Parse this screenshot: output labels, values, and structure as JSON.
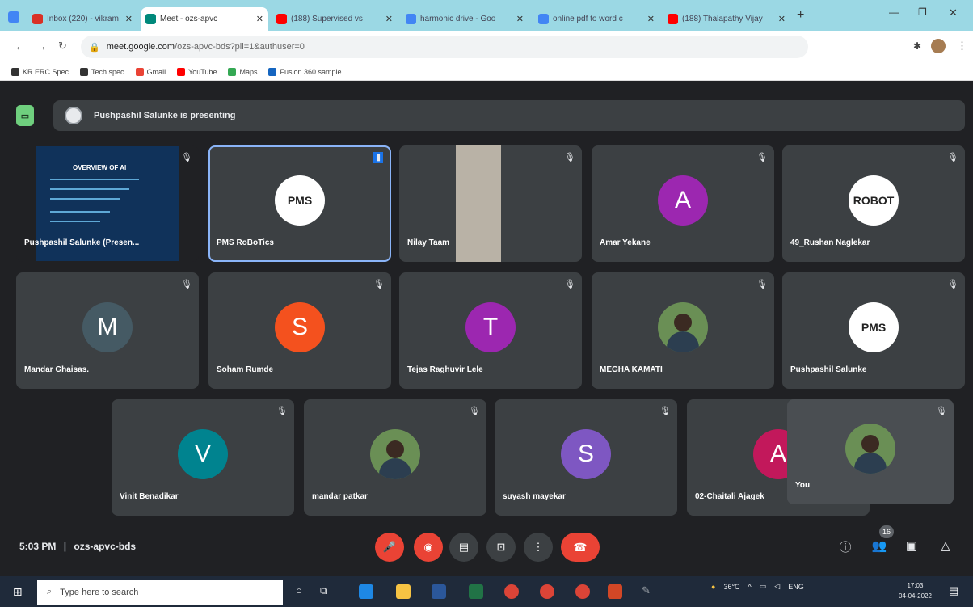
{
  "browser": {
    "tabs": [
      {
        "title": "Inbox (220) - vikram",
        "color": "#d93025"
      },
      {
        "title": "Meet - ozs-apvc",
        "color": "#00897b",
        "active": true
      },
      {
        "title": "(188) Supervised vs",
        "color": "#ff0000"
      },
      {
        "title": "harmonic drive - Goo",
        "color": "#4285f4"
      },
      {
        "title": "online pdf to word c",
        "color": "#4285f4"
      },
      {
        "title": "(188) Thalapathy Vijay",
        "color": "#ff0000"
      }
    ],
    "url_host": "meet.google.com",
    "url_path": "/ozs-apvc-bds?pli=1&authuser=0",
    "bookmarks": [
      "KR ERC Spec",
      "Tech spec",
      "Gmail",
      "YouTube",
      "Maps",
      "Fusion 360 sample..."
    ]
  },
  "meet": {
    "presenting_banner": "Pushpashil Salunke is presenting",
    "slide_title": "OVERVIEW OF AI",
    "tiles": [
      {
        "name": "Pushpashil Salunke (Presen...",
        "kind": "slide"
      },
      {
        "name": "PMS RoBoTics",
        "kind": "logo",
        "logo_text": "PMS",
        "speaking": true
      },
      {
        "name": "Nilay Taam",
        "kind": "video"
      },
      {
        "name": "Amar Yekane",
        "kind": "letter",
        "letter": "A",
        "color": "#9c27b0"
      },
      {
        "name": "49_Rushan Naglekar",
        "kind": "logo",
        "logo_text": "ROBOT"
      },
      {
        "name": "Mandar Ghaisas.",
        "kind": "letter",
        "letter": "M",
        "color": "#455a64"
      },
      {
        "name": "Soham Rumde",
        "kind": "letter",
        "letter": "S",
        "color": "#f4511e"
      },
      {
        "name": "Tejas Raghuvir Lele",
        "kind": "letter",
        "letter": "T",
        "color": "#9c27b0"
      },
      {
        "name": "MEGHA KAMATI",
        "kind": "photo"
      },
      {
        "name": "Pushpashil Salunke",
        "kind": "logo",
        "logo_text": "PMS"
      },
      {
        "name": "Vinit Benadikar",
        "kind": "letter",
        "letter": "V",
        "color": "#00838f"
      },
      {
        "name": "mandar patkar",
        "kind": "photo"
      },
      {
        "name": "suyash mayekar",
        "kind": "letter",
        "letter": "S",
        "color": "#7e57c2"
      },
      {
        "name": "02-Chaitali Ajagek",
        "kind": "letter",
        "letter": "A",
        "color": "#c2185b"
      },
      {
        "name": "You",
        "kind": "photo",
        "self": true
      }
    ],
    "time": "5:03 PM",
    "meeting_code": "ozs-apvc-bds",
    "participant_count": "16"
  },
  "taskbar": {
    "search_placeholder": "Type here to search",
    "weather": "36°C",
    "lang": "ENG",
    "time": "17:03",
    "date": "04-04-2022"
  }
}
